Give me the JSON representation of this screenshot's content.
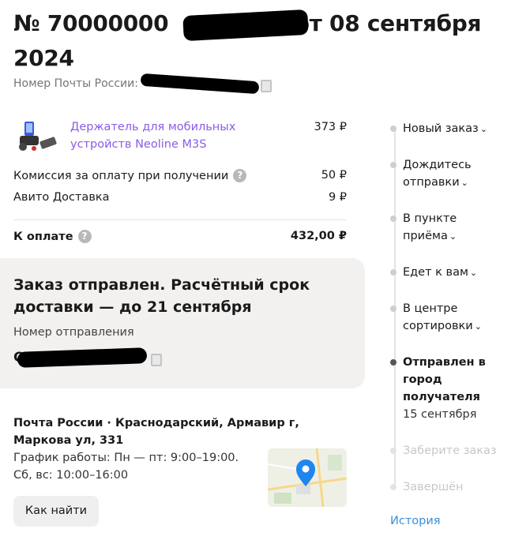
{
  "order": {
    "title_line1": "№ 70000000",
    "title_date": " от 08 сентября",
    "title_line2": "2024",
    "post_number_label": "Номер Почты России:"
  },
  "items": {
    "product_name": "Держатель для мобильных устройств Neoline M3S",
    "product_price": "373 ₽",
    "commission_label": "Комиссия за оплату при получении",
    "commission_value": "50 ₽",
    "delivery_label": "Авито Доставка",
    "delivery_value": "9 ₽",
    "total_label": "К оплате",
    "total_value": "432,00 ₽"
  },
  "status_card": {
    "title": "Заказ отправлен. Расчётный срок доставки — до 21 сентября",
    "tracking_label": "Номер отправления",
    "tracking_prefix": "C"
  },
  "pickup": {
    "address": "Почта России · Краснодарский, Армавир г, Маркова ул, 331",
    "hours_line1": "График работы: Пн — пт: 9:00–19:00.",
    "hours_line2": "Сб, вс: 10:00–16:00",
    "find_button": "Как найти"
  },
  "timeline": {
    "steps": [
      {
        "label": "Новый заказ",
        "state": "done"
      },
      {
        "label": "Дождитесь отправки",
        "state": "done"
      },
      {
        "label": "В пункте приёма",
        "state": "done"
      },
      {
        "label": "Едет к вам",
        "state": "done"
      },
      {
        "label": "В центре сортировки",
        "state": "done"
      },
      {
        "label": "Отправлен в город получателя",
        "state": "active",
        "date": "15 сентября"
      },
      {
        "label": "Заберите заказ",
        "state": "future"
      },
      {
        "label": "Завершён",
        "state": "future"
      }
    ],
    "history_link": "История"
  },
  "colors": {
    "link_purple": "#8a5ce6",
    "link_blue": "#3a8edb",
    "card_bg": "#f2f1f0",
    "map_pin": "#1f86f0"
  },
  "icons": [
    "question-icon",
    "copy-icon",
    "chevron-down-icon",
    "map-pin-icon"
  ]
}
